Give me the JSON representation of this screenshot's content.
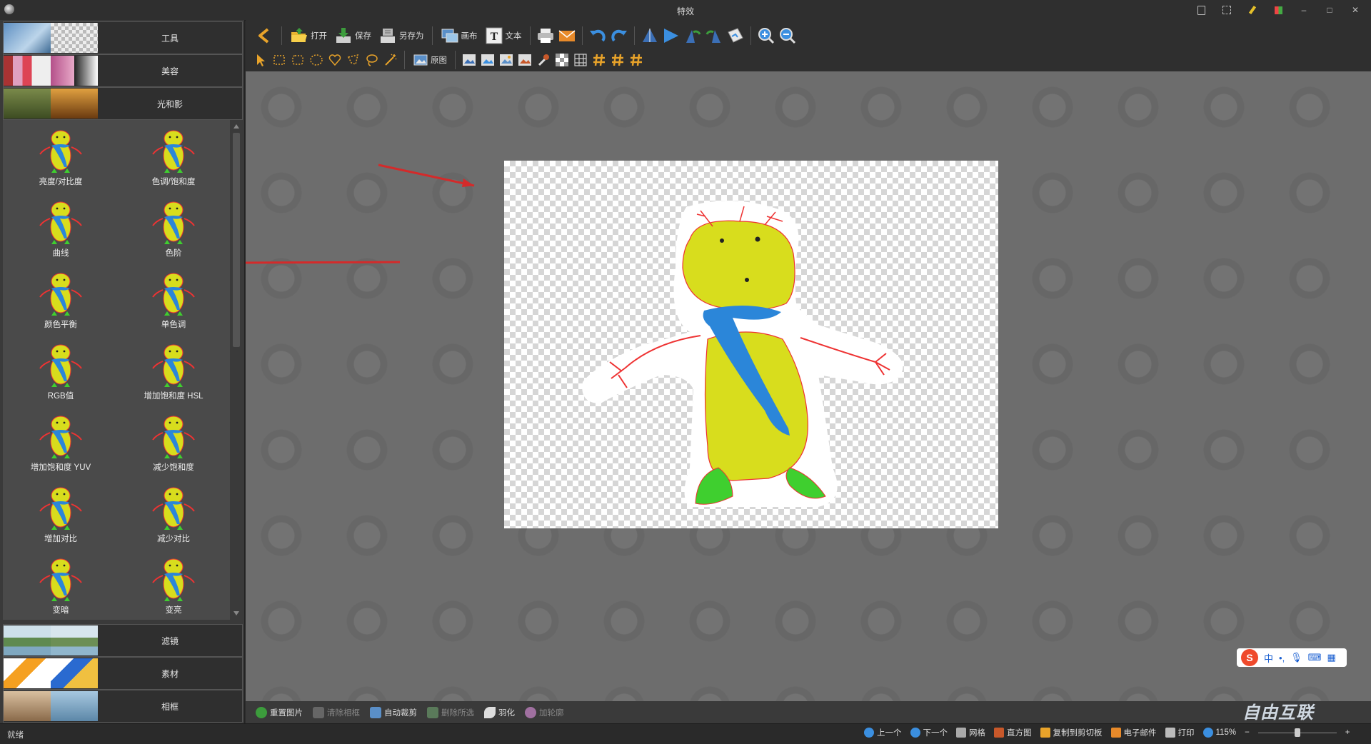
{
  "window": {
    "title": "特效",
    "controls": [
      "file-icon",
      "fullscreen-icon",
      "pen-icon",
      "grid-icon",
      "minimize",
      "maximize",
      "close"
    ],
    "control_glyphs": {
      "minimize": "–",
      "maximize": "□",
      "close": "✕"
    }
  },
  "left_panel": {
    "top_categories": [
      {
        "label": "工具"
      },
      {
        "label": "美容"
      },
      {
        "label": "光和影"
      }
    ],
    "bottom_categories": [
      {
        "label": "滤镜"
      },
      {
        "label": "素材"
      },
      {
        "label": "相框"
      }
    ],
    "effects": [
      "亮度/对比度",
      "色调/饱和度",
      "曲线",
      "色阶",
      "颜色平衡",
      "单色调",
      "RGB值",
      "增加饱和度 HSL",
      "增加饱和度 YUV",
      "减少饱和度",
      "增加对比",
      "减少对比",
      "变暗",
      "变亮"
    ],
    "icon": "penguin-figure-icon"
  },
  "toolbar": {
    "back_icon": "back-arrow-icon",
    "open_label": "打开",
    "save_label": "保存",
    "save_as_label": "另存为",
    "canvas_label": "画布",
    "text_label": "文本",
    "original_label": "原图"
  },
  "bottom_tools": {
    "reset": "重置图片",
    "clear_frame": "清除相框",
    "auto_crop": "自动裁剪",
    "delete_selection": "删除所选",
    "feather": "羽化",
    "add_outline": "加轮廓"
  },
  "status": {
    "ready": "就绪",
    "prev": "上一个",
    "next": "下一个",
    "grid": "网格",
    "histogram": "直方图",
    "copy_clipboard": "复制到剪切板",
    "email": "电子邮件",
    "print": "打印",
    "zoom": "115%",
    "zoom_fraction": 0.5
  },
  "ime": {
    "logo": "S",
    "mode": "中",
    "punct": "•,",
    "icons": [
      "mic-icon",
      "keyboard-icon",
      "apps-icon"
    ]
  },
  "watermark": "自由互联",
  "colors": {
    "accent": "#e8a32a",
    "annotation_arrow": "#d42a2a",
    "figure_yellow": "#d8dd1d",
    "figure_scarf": "#2b86d9",
    "figure_feet": "#3fcf2f"
  }
}
